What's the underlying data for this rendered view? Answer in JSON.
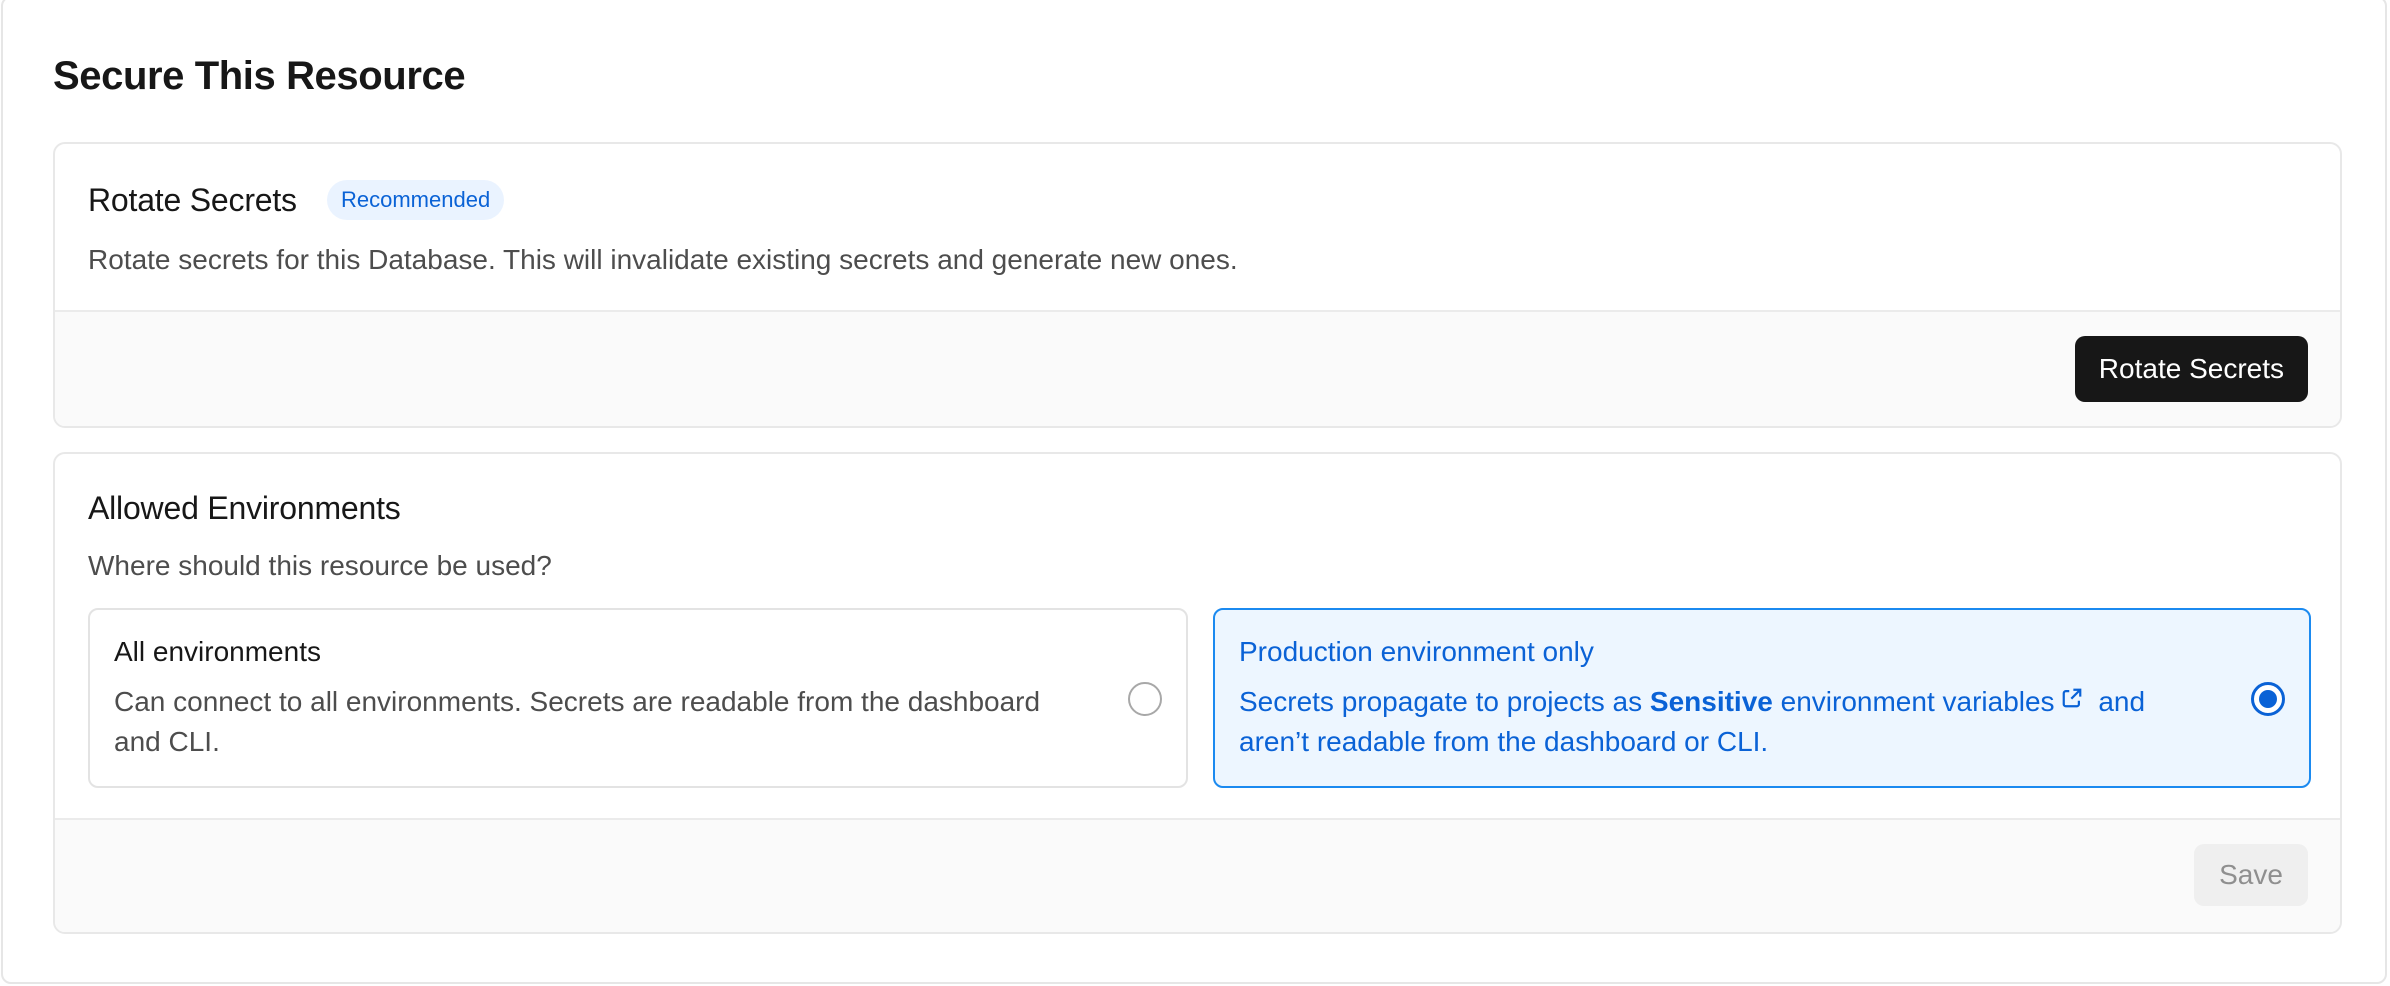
{
  "page": {
    "title": "Secure This Resource"
  },
  "rotate": {
    "title": "Rotate Secrets",
    "badge": "Recommended",
    "description": "Rotate secrets for this Database. This will invalidate existing secrets and generate new ones.",
    "button_label": "Rotate Secrets"
  },
  "environments": {
    "title": "Allowed Environments",
    "question": "Where should this resource be used?",
    "options": [
      {
        "title": "All environments",
        "text": "Can connect to all environments. Secrets are readable from the dashboard and CLI.",
        "selected": false
      },
      {
        "title": "Production environment only",
        "text_before": "Secrets propagate to projects as ",
        "text_bold": "Sensitive",
        "text_link": " environment variables",
        "text_after": " and aren’t readable from the dashboard or CLI.",
        "selected": true
      }
    ],
    "save_label": "Save"
  },
  "colors": {
    "accent": "#0a62d6",
    "selected_border": "#1b8af0",
    "selected_bg": "#edf6ff",
    "primary_button": "#171717"
  },
  "icons": {
    "external_link": "external-link-icon"
  }
}
